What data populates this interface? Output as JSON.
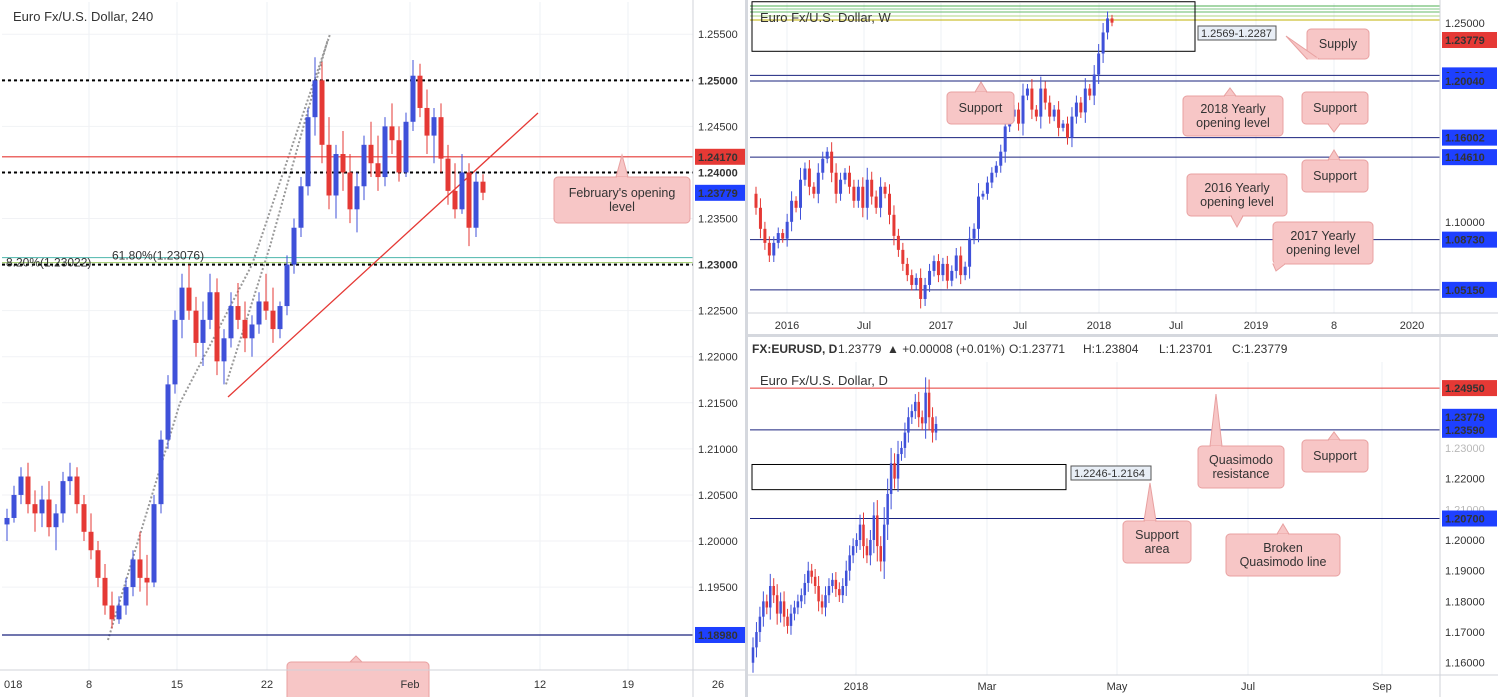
{
  "panels": [
    {
      "id": "h4",
      "title": "Euro Fx/U.S. Dollar, 240",
      "ylim": [
        1.186,
        1.2585
      ],
      "price_ticks": [
        "1.25500",
        "1.25000",
        "1.24500",
        "1.24000",
        "1.23500",
        "1.23000",
        "1.22500",
        "1.22000",
        "1.21500",
        "1.21000",
        "1.20500",
        "1.20000",
        "1.19500",
        "1.18980"
      ],
      "price_tick_values": [
        1.255,
        1.25,
        1.245,
        1.24,
        1.235,
        1.23,
        1.225,
        1.22,
        1.215,
        1.21,
        1.205,
        1.2,
        1.195,
        1.1898
      ],
      "x_ticks": [
        "018",
        "8",
        "15",
        "22",
        "Feb",
        "12",
        "19",
        "26"
      ],
      "levels": [
        {
          "name": "1.25000",
          "value": 1.25,
          "style": "dotted",
          "color": "#000000",
          "tag_bg": "#ffffff",
          "tag_fg": "#000000"
        },
        {
          "name": "1.24170",
          "value": 1.2417,
          "style": "solid",
          "color": "#e53935",
          "tag_bg": "#e53935",
          "tag_fg": "#ffffff"
        },
        {
          "name": "1.24000",
          "value": 1.24,
          "style": "dotted",
          "color": "#000000",
          "tag_bg": "#ffffff",
          "tag_fg": "#000000"
        },
        {
          "name": "1.23779",
          "value": 1.23779,
          "style": "none",
          "color": "#1e40ff",
          "tag_bg": "#1e40ff",
          "tag_fg": "#ffffff"
        },
        {
          "name": "1.23000",
          "value": 1.23,
          "style": "dotted",
          "color": "#000000",
          "tag_bg": "#ffffff",
          "tag_fg": "#000000"
        },
        {
          "name": "1.18980",
          "value": 1.1898,
          "style": "solid",
          "color": "#1a237e",
          "tag_bg": "#1e40ff",
          "tag_fg": "#ffffff"
        }
      ],
      "fib_labels": [
        "8.20%(1.23022)",
        "61.80%(1.23076)"
      ],
      "annotations": [
        {
          "text": "February's opening level",
          "lines": [
            "February's opening",
            "level"
          ]
        }
      ],
      "candles": [
        [
          1.2018,
          1.2035,
          1.2,
          1.2025
        ],
        [
          1.2025,
          1.206,
          1.202,
          1.205
        ],
        [
          1.205,
          1.208,
          1.204,
          1.207
        ],
        [
          1.207,
          1.2085,
          1.203,
          1.204
        ],
        [
          1.204,
          1.2055,
          1.201,
          1.203
        ],
        [
          1.203,
          1.206,
          1.2015,
          1.2045
        ],
        [
          1.2045,
          1.2065,
          1.2005,
          1.2015
        ],
        [
          1.2015,
          1.204,
          1.199,
          1.203
        ],
        [
          1.203,
          1.2075,
          1.202,
          1.2065
        ],
        [
          1.2065,
          1.2085,
          1.205,
          1.207
        ],
        [
          1.207,
          1.208,
          1.203,
          1.204
        ],
        [
          1.204,
          1.205,
          1.2,
          1.201
        ],
        [
          1.201,
          1.203,
          1.198,
          1.199
        ],
        [
          1.199,
          1.2,
          1.195,
          1.196
        ],
        [
          1.196,
          1.1975,
          1.192,
          1.193
        ],
        [
          1.193,
          1.1945,
          1.1905,
          1.1915
        ],
        [
          1.1915,
          1.194,
          1.191,
          1.193
        ],
        [
          1.193,
          1.196,
          1.192,
          1.195
        ],
        [
          1.195,
          1.199,
          1.194,
          1.198
        ],
        [
          1.198,
          1.201,
          1.1945,
          1.196
        ],
        [
          1.196,
          1.1985,
          1.193,
          1.1955
        ],
        [
          1.1955,
          1.205,
          1.195,
          1.204
        ],
        [
          1.204,
          1.212,
          1.203,
          1.211
        ],
        [
          1.211,
          1.218,
          1.21,
          1.217
        ],
        [
          1.217,
          1.225,
          1.216,
          1.224
        ],
        [
          1.224,
          1.229,
          1.222,
          1.2275
        ],
        [
          1.2275,
          1.23,
          1.224,
          1.225
        ],
        [
          1.225,
          1.2265,
          1.22,
          1.2215
        ],
        [
          1.2215,
          1.226,
          1.219,
          1.224
        ],
        [
          1.224,
          1.229,
          1.223,
          1.227
        ],
        [
          1.227,
          1.2285,
          1.218,
          1.2195
        ],
        [
          1.2195,
          1.223,
          1.217,
          1.222
        ],
        [
          1.222,
          1.227,
          1.221,
          1.2255
        ],
        [
          1.2255,
          1.228,
          1.223,
          1.224
        ],
        [
          1.224,
          1.226,
          1.2205,
          1.222
        ],
        [
          1.222,
          1.2245,
          1.22,
          1.2235
        ],
        [
          1.2235,
          1.227,
          1.2225,
          1.226
        ],
        [
          1.226,
          1.229,
          1.224,
          1.225
        ],
        [
          1.225,
          1.2275,
          1.2215,
          1.223
        ],
        [
          1.223,
          1.226,
          1.222,
          1.2255
        ],
        [
          1.2255,
          1.231,
          1.2245,
          1.23
        ],
        [
          1.23,
          1.235,
          1.229,
          1.234
        ],
        [
          1.234,
          1.2395,
          1.233,
          1.2385
        ],
        [
          1.2385,
          1.247,
          1.2375,
          1.246
        ],
        [
          1.246,
          1.2525,
          1.244,
          1.25
        ],
        [
          1.25,
          1.252,
          1.241,
          1.243
        ],
        [
          1.243,
          1.246,
          1.236,
          1.2375
        ],
        [
          1.2375,
          1.243,
          1.235,
          1.242
        ],
        [
          1.242,
          1.2445,
          1.238,
          1.24
        ],
        [
          1.24,
          1.242,
          1.2345,
          1.236
        ],
        [
          1.236,
          1.24,
          1.2335,
          1.2385
        ],
        [
          1.2385,
          1.244,
          1.237,
          1.243
        ],
        [
          1.243,
          1.2455,
          1.2395,
          1.241
        ],
        [
          1.241,
          1.244,
          1.238,
          1.2395
        ],
        [
          1.2395,
          1.246,
          1.2385,
          1.245
        ],
        [
          1.245,
          1.2475,
          1.242,
          1.2435
        ],
        [
          1.2435,
          1.245,
          1.239,
          1.24
        ],
        [
          1.24,
          1.2465,
          1.2395,
          1.2455
        ],
        [
          1.2455,
          1.2522,
          1.2445,
          1.2505
        ],
        [
          1.2505,
          1.2518,
          1.246,
          1.247
        ],
        [
          1.247,
          1.249,
          1.242,
          1.244
        ],
        [
          1.244,
          1.247,
          1.241,
          1.246
        ],
        [
          1.246,
          1.2475,
          1.24,
          1.2415
        ],
        [
          1.2415,
          1.243,
          1.2365,
          1.238
        ],
        [
          1.238,
          1.241,
          1.235,
          1.236
        ],
        [
          1.236,
          1.242,
          1.2355,
          1.24
        ],
        [
          1.24,
          1.241,
          1.232,
          1.234
        ],
        [
          1.234,
          1.24,
          1.233,
          1.239
        ],
        [
          1.239,
          1.2398,
          1.237,
          1.2378
        ]
      ]
    },
    {
      "id": "weekly",
      "title": "Euro Fx/U.S. Dollar, W",
      "ylim": [
        1.035,
        1.256
      ],
      "price_ticks": [
        "1.25000",
        "1.20440",
        "1.20040",
        "1.16002",
        "1.14610",
        "1.10000",
        "1.08730",
        "1.05150"
      ],
      "price_tick_values": [
        1.25,
        1.2044,
        1.2004,
        1.16002,
        1.1461,
        1.1,
        1.0873,
        1.0515
      ],
      "x_ticks": [
        "2016",
        "Jul",
        "2017",
        "Jul",
        "2018",
        "Jul",
        "2019",
        "8",
        "2020"
      ],
      "levels": [
        {
          "name": "1.20440",
          "value": 1.2044,
          "color": "#1a237e",
          "tag_bg": "#1e40ff",
          "tag_fg": "#ffffff"
        },
        {
          "name": "1.20040",
          "value": 1.2004,
          "color": "#1a237e",
          "tag_bg": "#1e40ff",
          "tag_fg": "#ffffff"
        },
        {
          "name": "1.16002",
          "value": 1.16002,
          "color": "#1a237e",
          "tag_bg": "#1e40ff",
          "tag_fg": "#ffffff"
        },
        {
          "name": "1.14610",
          "value": 1.1461,
          "color": "#1a237e",
          "tag_bg": "#1e40ff",
          "tag_fg": "#ffffff"
        },
        {
          "name": "1.08730",
          "value": 1.0873,
          "color": "#1a237e",
          "tag_bg": "#1e40ff",
          "tag_fg": "#ffffff"
        },
        {
          "name": "1.05150",
          "value": 1.0515,
          "color": "#1a237e",
          "tag_bg": "#1e40ff",
          "tag_fg": "#ffffff"
        }
      ],
      "current": {
        "name": "1.23779",
        "value": 1.23779,
        "tag_bg": "#e53935",
        "tag_fg": "#ffffff"
      },
      "zone_label": "1.2569-1.2287",
      "annotations": [
        {
          "text": "Supply",
          "lines": [
            "Supply"
          ]
        },
        {
          "text": "Support",
          "lines": [
            "Support"
          ]
        },
        {
          "text": "2018 Yearly opening level",
          "lines": [
            "2018 Yearly",
            "opening level"
          ]
        },
        {
          "text": "Support",
          "lines": [
            "Support"
          ]
        },
        {
          "text": "Support",
          "lines": [
            "Support"
          ]
        },
        {
          "text": "2016 Yearly opening level",
          "lines": [
            "2016 Yearly",
            "opening level"
          ]
        },
        {
          "text": "2017 Yearly opening level",
          "lines": [
            "2017 Yearly",
            "opening level"
          ]
        }
      ],
      "closes": [
        1.11,
        1.095,
        1.085,
        1.076,
        1.085,
        1.092,
        1.088,
        1.1,
        1.115,
        1.11,
        1.13,
        1.138,
        1.125,
        1.12,
        1.135,
        1.145,
        1.15,
        1.135,
        1.12,
        1.13,
        1.135,
        1.125,
        1.115,
        1.125,
        1.11,
        1.13,
        1.118,
        1.11,
        1.125,
        1.12,
        1.105,
        1.09,
        1.08,
        1.07,
        1.062,
        1.055,
        1.06,
        1.045,
        1.055,
        1.065,
        1.072,
        1.062,
        1.07,
        1.058,
        1.065,
        1.076,
        1.062,
        1.068,
        1.088,
        1.095,
        1.118,
        1.12,
        1.128,
        1.135,
        1.14,
        1.15,
        1.168,
        1.175,
        1.18,
        1.17,
        1.19,
        1.195,
        1.18,
        1.175,
        1.195,
        1.185,
        1.175,
        1.18,
        1.167,
        1.17,
        1.16,
        1.175,
        1.185,
        1.178,
        1.195,
        1.19,
        1.205,
        1.22,
        1.235,
        1.245,
        1.242
      ]
    },
    {
      "id": "daily",
      "title": "Euro Fx/U.S. Dollar, D",
      "header": {
        "symbol": "FX:EURUSD, D",
        "last": "1.23779",
        "change": "▲ +0.00008 (+0.01%)",
        "o": "O:1.23771",
        "h": "H:1.23804",
        "l": "L:1.23701",
        "c": "C:1.23779"
      },
      "ylim": [
        1.156,
        1.258
      ],
      "price_ticks": [
        "1.24950",
        "1.24000",
        "1.23779",
        "1.23590",
        "1.23000",
        "1.22000",
        "1.21000",
        "1.20700",
        "1.20000",
        "1.19000",
        "1.18000",
        "1.17000",
        "1.16000"
      ],
      "price_tick_values": [
        1.2495,
        1.24,
        1.23779,
        1.2359,
        1.23,
        1.22,
        1.21,
        1.207,
        1.2,
        1.19,
        1.18,
        1.17,
        1.16
      ],
      "x_ticks": [
        "2018",
        "Mar",
        "May",
        "Jul",
        "Sep"
      ],
      "levels": [
        {
          "name": "1.24950",
          "value": 1.2495,
          "color": "#e53935",
          "tag_bg": "#e53935",
          "tag_fg": "#ffffff"
        },
        {
          "name": "1.23590",
          "value": 1.2359,
          "color": "#1a237e",
          "tag_bg": "#1e40ff",
          "tag_fg": "#ffffff"
        },
        {
          "name": "1.20700",
          "value": 1.207,
          "color": "#1a237e",
          "tag_bg": "#1e40ff",
          "tag_fg": "#ffffff"
        }
      ],
      "current": {
        "name": "1.23779",
        "value": 1.23779,
        "tag_bg": "#1e40ff",
        "tag_fg": "#ffffff"
      },
      "zone_label": "1.2246-1.2164",
      "annotations": [
        {
          "text": "Quasimodo resistance",
          "lines": [
            "Quasimodo",
            "resistance"
          ]
        },
        {
          "text": "Support",
          "lines": [
            "Support"
          ]
        },
        {
          "text": "Support area",
          "lines": [
            "Support",
            "area"
          ]
        },
        {
          "text": "Broken Quasimodo line",
          "lines": [
            "Broken",
            "Quasimodo line"
          ]
        }
      ],
      "closes": [
        1.165,
        1.17,
        1.175,
        1.18,
        1.178,
        1.185,
        1.182,
        1.176,
        1.18,
        1.175,
        1.172,
        1.176,
        1.178,
        1.18,
        1.182,
        1.186,
        1.19,
        1.188,
        1.185,
        1.18,
        1.178,
        1.182,
        1.185,
        1.187,
        1.184,
        1.182,
        1.185,
        1.19,
        1.195,
        1.198,
        1.2,
        1.205,
        1.198,
        1.195,
        1.2,
        1.208,
        1.198,
        1.193,
        1.205,
        1.215,
        1.225,
        1.22,
        1.228,
        1.23,
        1.235,
        1.24,
        1.242,
        1.245,
        1.24,
        1.238,
        1.248,
        1.24,
        1.235,
        1.2378
      ]
    }
  ]
}
